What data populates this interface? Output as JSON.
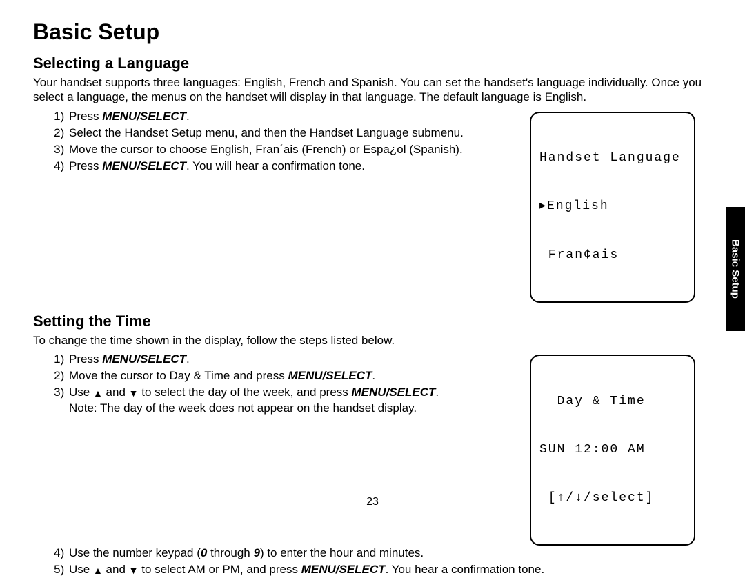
{
  "page_title": "Basic Setup",
  "tab_label": "Basic Setup",
  "page_number": "23",
  "section_language": {
    "heading": "Selecting a Language",
    "intro": "Your handset supports three languages: English, French and Spanish. You can set the handset's language individually. Once you select a language, the menus on the handset will display in that language. The default language is English.",
    "steps": {
      "s1_a": "Press ",
      "s1_b": "MENU/SELECT",
      "s1_c": ".",
      "s2": "Select the Handset Setup menu, and then the Handset Language submenu.",
      "s3": "Move the cursor to choose English, Fran´ais (French) or Espa¿ol (Spanish).",
      "s4_a": "Press ",
      "s4_b": "MENU/SELECT",
      "s4_c": ". You will hear a confirmation tone."
    },
    "lcd": {
      "line1": "Handset Language",
      "line2": "▸English",
      "line3": " Fran¢ais"
    }
  },
  "section_time": {
    "heading": "Setting the Time",
    "intro": "To change the time shown in the display, follow the steps listed below.",
    "steps": {
      "s1_a": "Press ",
      "s1_b": "MENU/SELECT",
      "s1_c": ".",
      "s2_a": "Move the cursor to Day & Time and press ",
      "s2_b": "MENU/SELECT",
      "s2_c": ".",
      "s3_a": "Use ",
      "s3_b": " and ",
      "s3_c": " to select the day of the week, and press ",
      "s3_d": "MENU/SELECT",
      "s3_e": ".",
      "s3_note": "Note: The day of the week does not appear on the handset display.",
      "s4_a": "Use the number keypad (",
      "s4_b": "0",
      "s4_c": " through ",
      "s4_d": "9",
      "s4_e": ") to enter the hour and minutes.",
      "s5_a": "Use ",
      "s5_b": " and ",
      "s5_c": " to select AM or PM, and press ",
      "s5_d": "MENU/SELECT",
      "s5_e": ". You hear a confirmation tone."
    },
    "lcd": {
      "line1": "  Day & Time",
      "line2": "SUN 12:00 AM",
      "line3": " [↑/↓/select]"
    }
  }
}
